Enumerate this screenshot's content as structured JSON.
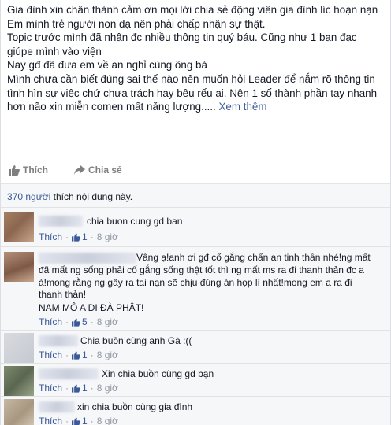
{
  "post": {
    "paragraphs": [
      "Gia đình xin chân thành cảm ơn mọi lời chia sẻ động viên gia đình líc hoạn nạn",
      "Em mình trẻ người non dạ nên phải chấp nhận sự thật.",
      "Topic trước mình đã nhận đc nhiều thông tin quý báu. Cũng như 1 bạn đạc giúpe mình vào viện",
      "Nay gđ đã đưa em về an nghỉ cùng ông bà",
      "Mình chưa cần biết đúng sai thế nào nên muốn hỏi Leader để nắm rõ thông tin tình hìn sự việc chứ chưa trách hay bêu rếu ai. Nên 1 số thành phần tay nhanh hơn não xin miễn comen mất năng lượng....."
    ],
    "see_more": "Xem thêm"
  },
  "actions": {
    "like_label": "Thích",
    "share_label": "Chia sẻ"
  },
  "likes_summary": {
    "count_text": "370 người",
    "rest_text": " thích nội dung này."
  },
  "comments": [
    {
      "text": "chia buon cung gd ban",
      "like_label": "Thích",
      "likes": "1",
      "time": "8 giờ"
    },
    {
      "text": "Vâng ạ!anh ơi gđ cố gắng chấn an tinh thần nhé!ng mất đã mất ng sống phải cố gắng sống thật tốt thì ng mất ms ra đi thanh thản đc a à!mong rằng ng gây ra tai nạn sẽ chịu đúng án họp lí nhất!mong em a ra đi thanh thản!",
      "text2": "NAM MÔ A DI ĐÀ PHẬT!",
      "like_label": "Thích",
      "likes": "5",
      "time": "8 giờ"
    },
    {
      "text": "Chia buồn cùng anh Gà :((",
      "like_label": "Thích",
      "likes": "1",
      "time": "8 giờ"
    },
    {
      "text": "Xin chia buồn cùng gđ bạn",
      "like_label": "Thích",
      "likes": "1",
      "time": "8 giờ"
    },
    {
      "text": "xin chia buồn cùng gia đình",
      "like_label": "Thích",
      "likes": "1",
      "time": "8 giờ"
    }
  ],
  "colors": {
    "link": "#3b5998",
    "meta": "#9197a3",
    "comment_bg": "#f6f7f9"
  },
  "icons": {
    "like": "thumbs-up-icon",
    "share": "share-arrow-icon"
  }
}
